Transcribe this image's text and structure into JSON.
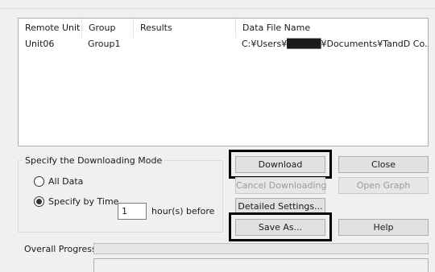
{
  "list": {
    "columns": [
      "Remote Unit",
      "Group",
      "Results",
      "Data File Name"
    ],
    "rows": [
      {
        "remote_unit": "Unit06",
        "group": "Group1",
        "results": "",
        "data_file_name": "C:¥Users¥█████¥Documents¥TandD Co..."
      }
    ]
  },
  "mode": {
    "title": "Specify the Downloading Mode",
    "all_data_label": "All Data",
    "specify_time_label": "Specify by Time",
    "selected": "specify_by_time",
    "hours_value": "1",
    "hours_suffix": "hour(s) before"
  },
  "buttons": {
    "download": "Download",
    "close": "Close",
    "cancel_downloading": "Cancel Downloading",
    "open_graph": "Open Graph",
    "detailed_settings": "Detailed Settings...",
    "save_as": "Save As...",
    "help": "Help"
  },
  "progress": {
    "label": "Overall Progress",
    "value": 0
  }
}
